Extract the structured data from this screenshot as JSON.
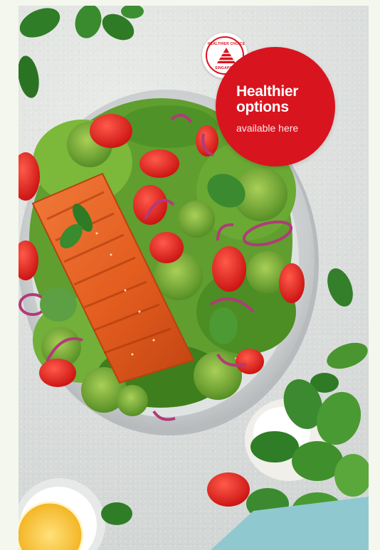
{
  "badge": {
    "title_line1": "Healthier",
    "title_line2": "options",
    "subtitle": "available here",
    "logo_text_top": "HEALTHIER CHOICE",
    "logo_text_bottom": "SINGAPORE",
    "color": "#d8141f"
  },
  "scene": {
    "description_icon": "salmon-salad-bowl-photo"
  }
}
